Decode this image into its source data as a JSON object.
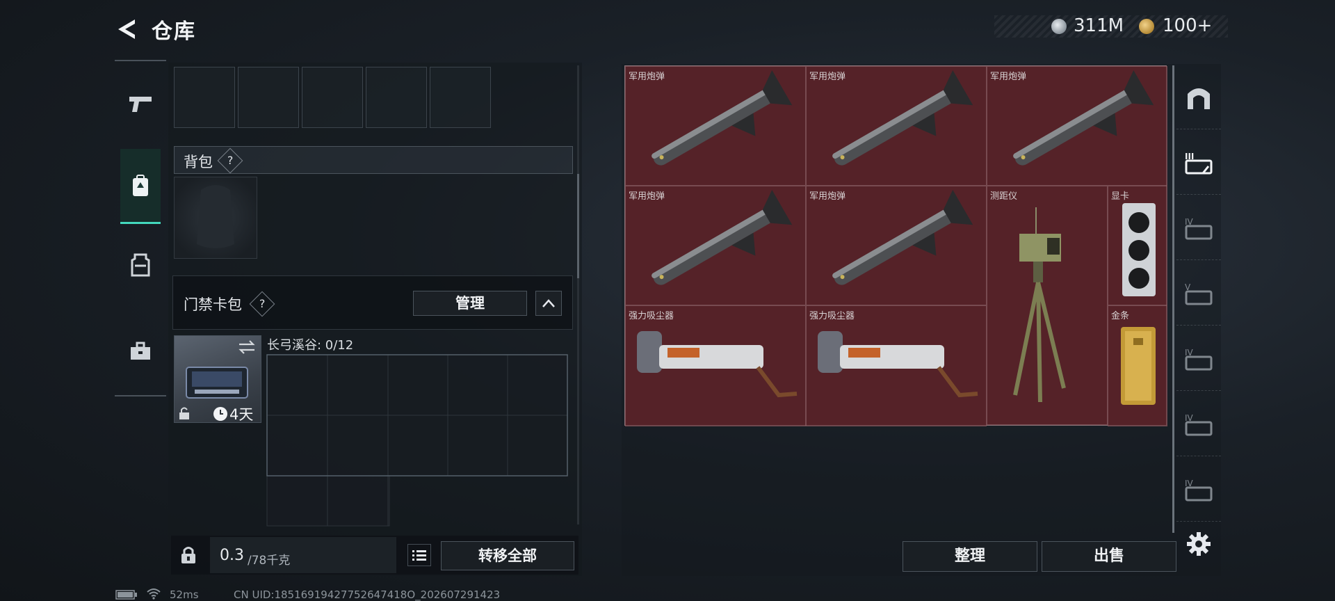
{
  "header": {
    "title": "仓库",
    "silver_currency": "311M",
    "gold_currency": "100+"
  },
  "left_nav": {
    "items": [
      {
        "name": "weapon",
        "icon": "pistol-icon",
        "active": false
      },
      {
        "name": "backpack",
        "icon": "backpack-icon",
        "active": true
      },
      {
        "name": "vest",
        "icon": "vest-icon",
        "active": false
      },
      {
        "name": "case",
        "icon": "briefcase-icon",
        "active": false
      }
    ]
  },
  "backpack_section": {
    "label": "背包",
    "help": "?"
  },
  "keycard_section": {
    "label": "门禁卡包",
    "help": "?",
    "manage_label": "管理"
  },
  "keycase": {
    "days_left": "4天",
    "grid_title": "长弓溪谷: 0/12"
  },
  "bottom_left": {
    "weight_current": "0.3",
    "weight_capacity": "/78千克",
    "transfer_all_label": "转移全部"
  },
  "stash_items": [
    {
      "label": "军用炮弹",
      "kind": "missile"
    },
    {
      "label": "军用炮弹",
      "kind": "missile"
    },
    {
      "label": "军用炮弹",
      "kind": "missile"
    },
    {
      "label": "军用炮弹",
      "kind": "missile"
    },
    {
      "label": "军用炮弹",
      "kind": "missile"
    },
    {
      "label": "测距仪",
      "kind": "rangefinder"
    },
    {
      "label": "显卡",
      "kind": "gpu"
    },
    {
      "label": "强力吸尘器",
      "kind": "vacuum"
    },
    {
      "label": "强力吸尘器",
      "kind": "vacuum"
    },
    {
      "label": "金条",
      "kind": "gold-bar"
    }
  ],
  "right_tabs": {
    "tabs": [
      {
        "icon": "stash-arch-icon",
        "roman": ""
      },
      {
        "icon": "stash-tab-3-icon",
        "roman": "III"
      },
      {
        "icon": "stash-tab-4-icon",
        "roman": "IV"
      },
      {
        "icon": "stash-tab-5-icon",
        "roman": "V"
      },
      {
        "icon": "stash-tab-6-icon",
        "roman": "IV"
      },
      {
        "icon": "stash-tab-7-icon",
        "roman": "IV"
      },
      {
        "icon": "stash-tab-8-icon",
        "roman": "IV"
      }
    ]
  },
  "actions": {
    "organize_label": "整理",
    "sell_label": "出售"
  },
  "status_bar": {
    "ping": "52ms",
    "uid": "CN UID:18516919427752647418O_202607291423"
  },
  "colors": {
    "accent": "#43d8bd",
    "stash_cell": "#5f232a",
    "panel": "#14191e"
  }
}
